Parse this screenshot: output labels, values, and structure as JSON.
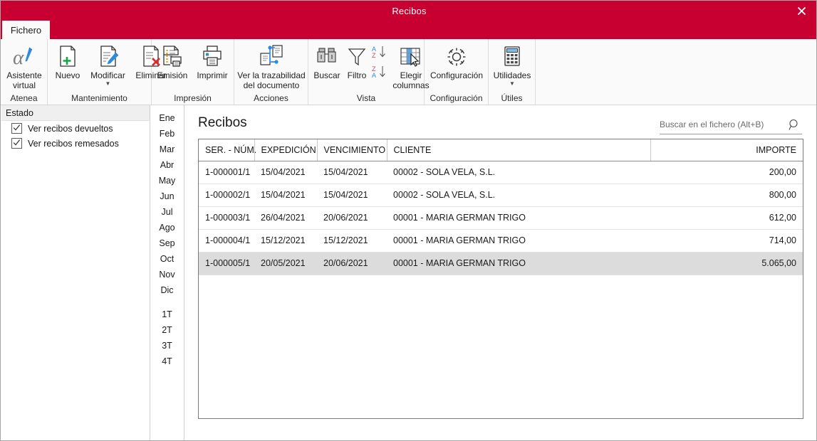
{
  "window": {
    "title": "Recibos",
    "close_label": "close-window",
    "accent_color": "#c80032"
  },
  "tabs": [
    {
      "label": "Fichero",
      "active": true
    }
  ],
  "ribbon": {
    "groups": [
      {
        "name": "atenea",
        "label": "Atenea",
        "buttons": [
          {
            "name": "asistente-virtual",
            "label": "Asistente\nvirtual",
            "icon": "alpha-icon",
            "caret": false
          }
        ]
      },
      {
        "name": "mantenimiento",
        "label": "Mantenimiento",
        "buttons": [
          {
            "name": "nuevo",
            "label": "Nuevo",
            "icon": "document-plus-icon",
            "caret": false
          },
          {
            "name": "modificar",
            "label": "Modificar",
            "icon": "document-pencil-icon",
            "caret": true
          },
          {
            "name": "eliminar",
            "label": "Eliminar",
            "icon": "document-delete-icon",
            "caret": false
          }
        ]
      },
      {
        "name": "impresion",
        "label": "Impresión",
        "buttons": [
          {
            "name": "emision",
            "label": "Emisión",
            "icon": "document-print-icon",
            "caret": false
          },
          {
            "name": "imprimir",
            "label": "Imprimir",
            "icon": "printer-icon",
            "caret": false
          }
        ]
      },
      {
        "name": "acciones",
        "label": "Acciones",
        "buttons": [
          {
            "name": "ver-trazabilidad",
            "label": "Ver la trazabilidad\ndel documento",
            "icon": "traceability-icon",
            "caret": false
          }
        ]
      },
      {
        "name": "vista",
        "label": "Vista",
        "buttons": [
          {
            "name": "buscar",
            "label": "Buscar",
            "icon": "binoculars-icon",
            "caret": false
          },
          {
            "name": "filtro",
            "label": "Filtro",
            "icon": "funnel-icon",
            "caret": false
          },
          {
            "name": "ordenar-az",
            "label": "",
            "icon": "sort-az-icon",
            "caret": false
          },
          {
            "name": "ordenar-za",
            "label": "",
            "icon": "sort-za-icon",
            "caret": false
          },
          {
            "name": "elegir-columnas",
            "label": "Elegir\ncolumnas",
            "icon": "choose-columns-icon",
            "caret": false
          }
        ]
      },
      {
        "name": "configuracion",
        "label": "Configuración",
        "buttons": [
          {
            "name": "configuracion",
            "label": "Configuración",
            "icon": "gear-icon",
            "caret": false
          }
        ]
      },
      {
        "name": "utiles",
        "label": "Útiles",
        "buttons": [
          {
            "name": "utilidades",
            "label": "Utilidades",
            "icon": "calculator-icon",
            "caret": true
          }
        ]
      }
    ]
  },
  "sidebar": {
    "header": "Estado",
    "checkboxes": [
      {
        "label": "Ver recibos devueltos",
        "checked": true
      },
      {
        "label": "Ver recibos remesados",
        "checked": true
      }
    ]
  },
  "months": [
    {
      "label": "Ene",
      "gap": false
    },
    {
      "label": "Feb",
      "gap": false
    },
    {
      "label": "Mar",
      "gap": false
    },
    {
      "label": "Abr",
      "gap": false
    },
    {
      "label": "May",
      "gap": false
    },
    {
      "label": "Jun",
      "gap": false
    },
    {
      "label": "Jul",
      "gap": false
    },
    {
      "label": "Ago",
      "gap": false
    },
    {
      "label": "Sep",
      "gap": false
    },
    {
      "label": "Oct",
      "gap": false
    },
    {
      "label": "Nov",
      "gap": false
    },
    {
      "label": "Dic",
      "gap": false
    },
    {
      "label": "1T",
      "gap": true
    },
    {
      "label": "2T",
      "gap": false
    },
    {
      "label": "3T",
      "gap": false
    },
    {
      "label": "4T",
      "gap": false
    }
  ],
  "content": {
    "title": "Recibos",
    "search": {
      "placeholder": "Buscar en el fichero (Alt+B)",
      "value": ""
    },
    "table": {
      "columns": [
        {
          "key": "ser",
          "label": "SER. - NÚM.",
          "align": "left"
        },
        {
          "key": "exp",
          "label": "EXPEDICIÓN",
          "align": "left"
        },
        {
          "key": "ven",
          "label": "VENCIMIENTO",
          "align": "left"
        },
        {
          "key": "cli",
          "label": "CLIENTE",
          "align": "left"
        },
        {
          "key": "imp",
          "label": "IMPORTE",
          "align": "right"
        }
      ],
      "rows": [
        {
          "ser": "1-000001/1",
          "exp": "15/04/2021",
          "ven": "15/04/2021",
          "cli": "00002 - SOLA VELA, S.L.",
          "imp": "200,00",
          "selected": false
        },
        {
          "ser": "1-000002/1",
          "exp": "15/04/2021",
          "ven": "15/04/2021",
          "cli": "00002 - SOLA VELA, S.L.",
          "imp": "800,00",
          "selected": false
        },
        {
          "ser": "1-000003/1",
          "exp": "26/04/2021",
          "ven": "20/06/2021",
          "cli": "00001 - MARIA GERMAN TRIGO",
          "imp": "612,00",
          "selected": false
        },
        {
          "ser": "1-000004/1",
          "exp": "15/12/2021",
          "ven": "15/12/2021",
          "cli": "00001 - MARIA GERMAN TRIGO",
          "imp": "714,00",
          "selected": false
        },
        {
          "ser": "1-000005/1",
          "exp": "20/05/2021",
          "ven": "20/06/2021",
          "cli": "00001 - MARIA GERMAN TRIGO",
          "imp": "5.065,00",
          "selected": true
        }
      ]
    }
  }
}
